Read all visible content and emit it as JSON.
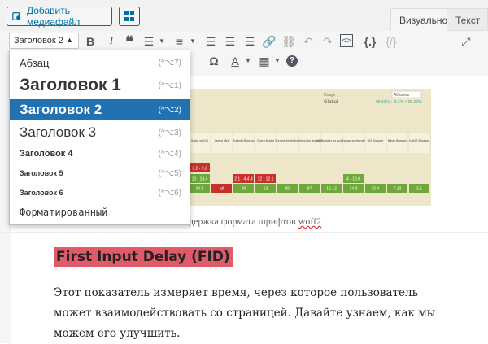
{
  "toolbar_top": {
    "add_media_label": "Добавить медиафайл",
    "tabs": [
      {
        "label": "Визуально",
        "active": true
      },
      {
        "label": "Текст",
        "active": false
      }
    ]
  },
  "format_select": {
    "value": "Заголовок 2"
  },
  "format_menu": {
    "items": [
      {
        "label": "Абзац",
        "shortcut": "(^⌥7)"
      },
      {
        "label": "Заголовок 1",
        "shortcut": "(^⌥1)"
      },
      {
        "label": "Заголовок 2",
        "shortcut": "(^⌥2)",
        "selected": true
      },
      {
        "label": "Заголовок 3",
        "shortcut": "(^⌥3)"
      },
      {
        "label": "Заголовок 4",
        "shortcut": "(^⌥4)"
      },
      {
        "label": "Заголовок 5",
        "shortcut": "(^⌥5)"
      },
      {
        "label": "Заголовок 6",
        "shortcut": "(^⌥6)"
      },
      {
        "label": "Форматированный",
        "shortcut": ""
      }
    ]
  },
  "content": {
    "image_caption_prefix": "держка формата шрифтов ",
    "image_caption_word": "woff2",
    "heading": "First Input Delay (FID)",
    "paragraph": "Этот показатель измеряет время, через которое пользователь может взаимодействовать со страницей. Давайте узнаем, как мы можем его улучшить."
  },
  "chart_image": {
    "usage_label": "Usage",
    "global_label": "Global",
    "percent": "95.62% + 0.1% = 95.62%",
    "filter": "All users",
    "browsers": [
      "Safari on iOS",
      "Opera Mini",
      "Android Browser",
      "Opera Mobile",
      "Chrome for Android",
      "Firefox for Android",
      "UC Browser for Android",
      "Samsung Internet",
      "QQ Browser",
      "Baidu Browser",
      "KaiOS Browser"
    ],
    "row1": [
      "3.2 - 9.3",
      "",
      "",
      "",
      "",
      "",
      "",
      "",
      "",
      "",
      ""
    ],
    "row2": [
      "10 - 14.4",
      "",
      "2.1 - 4.4.4",
      "12 - 12.1",
      "",
      "",
      "",
      "4 - 13.0",
      "",
      "",
      ""
    ],
    "row3": [
      "14.5",
      "all",
      "90",
      "62",
      "90",
      "87",
      "12.12",
      "14.0",
      "10.4",
      "7.12",
      "2.5"
    ]
  },
  "colors": {
    "accent": "#2271b1",
    "highlight": "#e05a6a",
    "supported": "#6fa83a",
    "unsupported": "#c9302c"
  }
}
